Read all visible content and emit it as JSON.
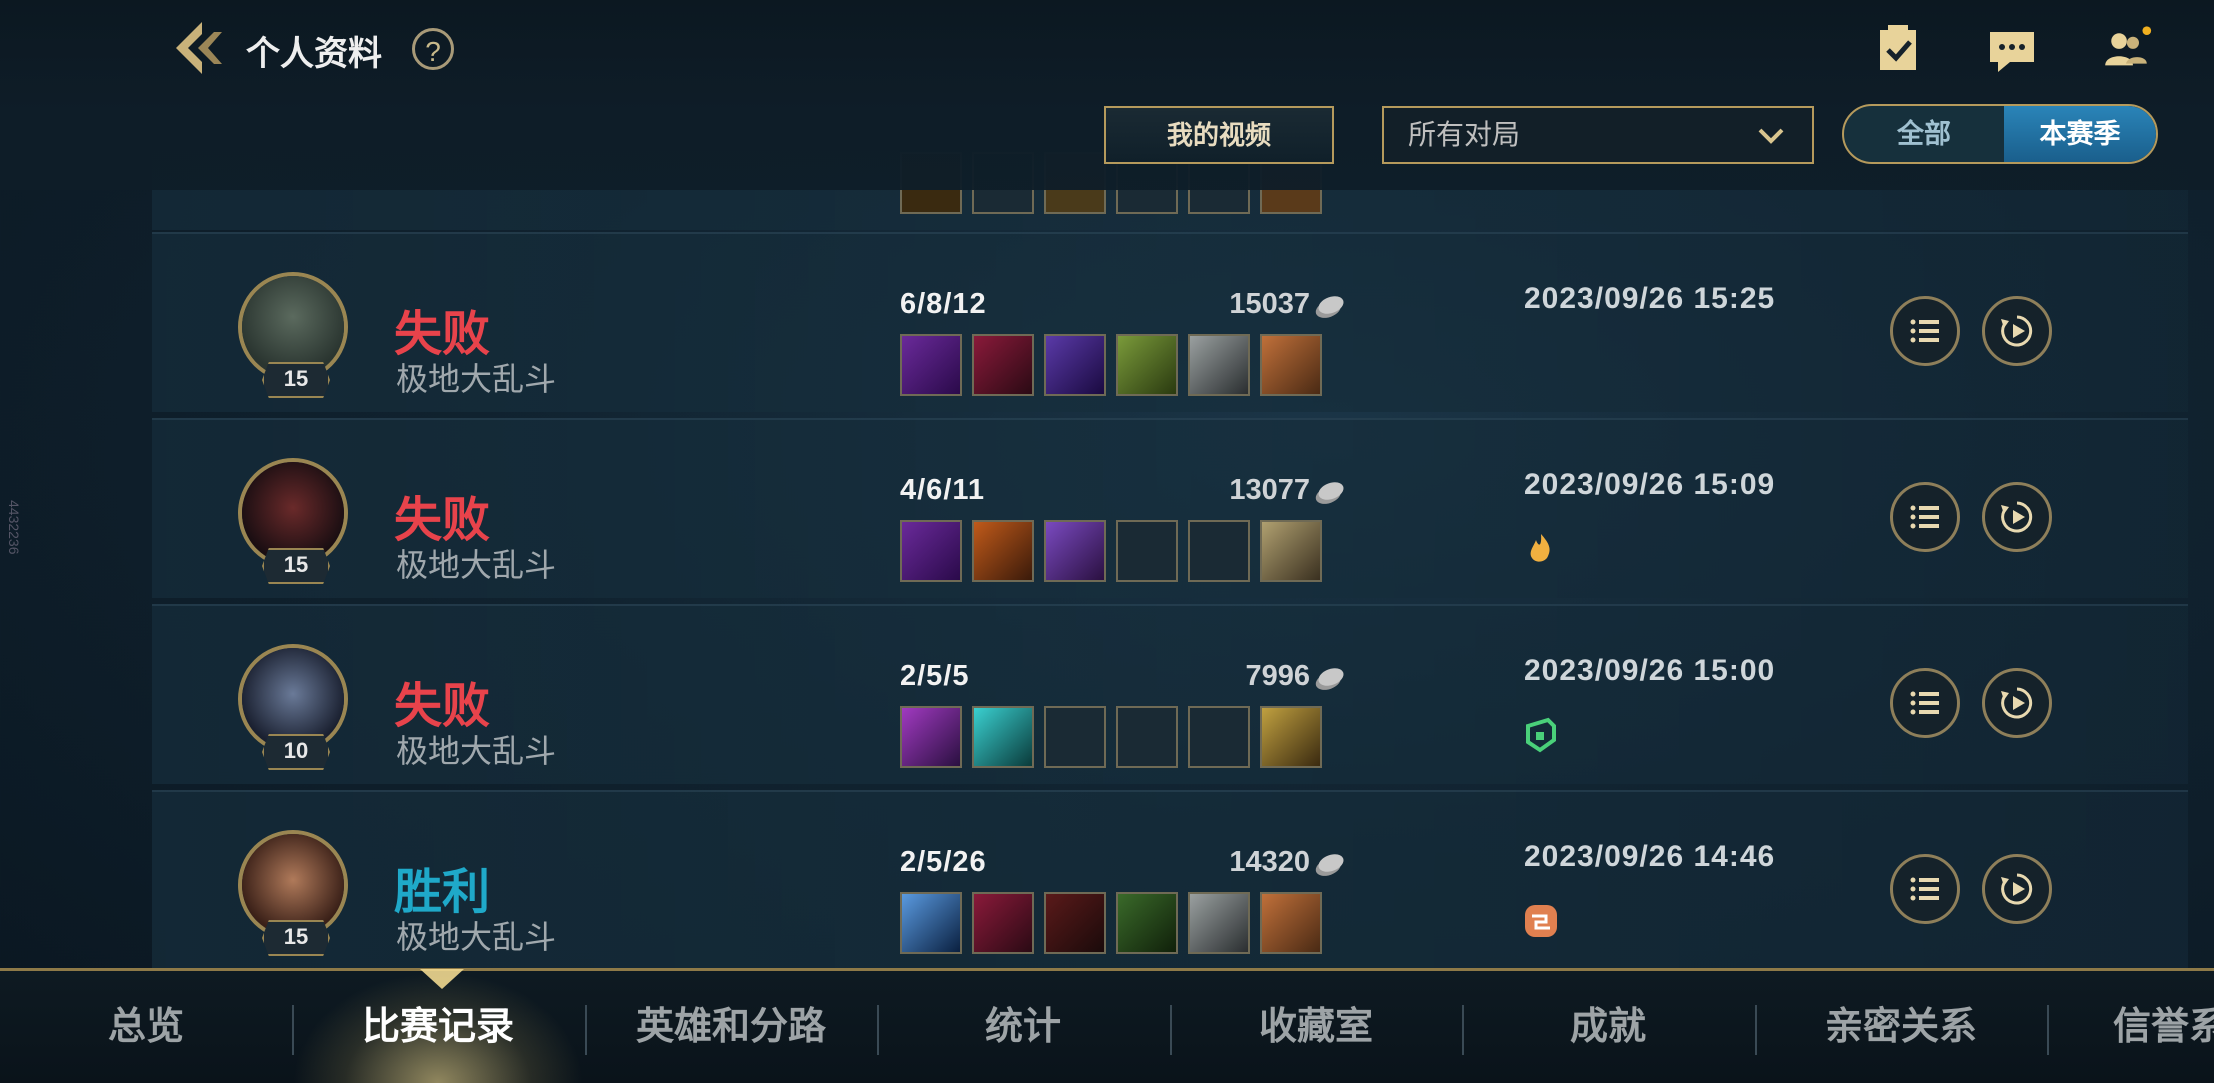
{
  "header": {
    "title": "个人资料",
    "help_label": "?",
    "my_video_label": "我的视频",
    "filter_value": "所有对局",
    "toggle": {
      "all_label": "全部",
      "season_label": "本赛季"
    }
  },
  "side_id": "4432236",
  "matches": [
    {
      "result": "失败",
      "result_type": "loss",
      "mode": "极地大乱斗",
      "level": "15",
      "kda": "6/8/12",
      "gold": "15037",
      "date": "2023/09/26 15:25",
      "badge": ""
    },
    {
      "result": "失败",
      "result_type": "loss",
      "mode": "极地大乱斗",
      "level": "15",
      "kda": "4/6/11",
      "gold": "13077",
      "date": "2023/09/26 15:09",
      "badge": "flame-badge-icon"
    },
    {
      "result": "失败",
      "result_type": "loss",
      "mode": "极地大乱斗",
      "level": "10",
      "kda": "2/5/5",
      "gold": "7996",
      "date": "2023/09/26 15:00",
      "badge": "shield-badge-icon"
    },
    {
      "result": "胜利",
      "result_type": "win",
      "mode": "极地大乱斗",
      "level": "15",
      "kda": "2/5/26",
      "gold": "14320",
      "date": "2023/09/26 14:46",
      "badge": "link-badge-icon"
    }
  ],
  "tabs": [
    "总览",
    "比赛记录",
    "英雄和分路",
    "统计",
    "收藏室",
    "成就",
    "亲密关系",
    "信誉系"
  ],
  "active_tab": "比赛记录",
  "colors": {
    "loss": "#e8434b",
    "win": "#1fa9c9",
    "gold_border": "#b59a5c",
    "accent_blue": "#2a84b8"
  }
}
